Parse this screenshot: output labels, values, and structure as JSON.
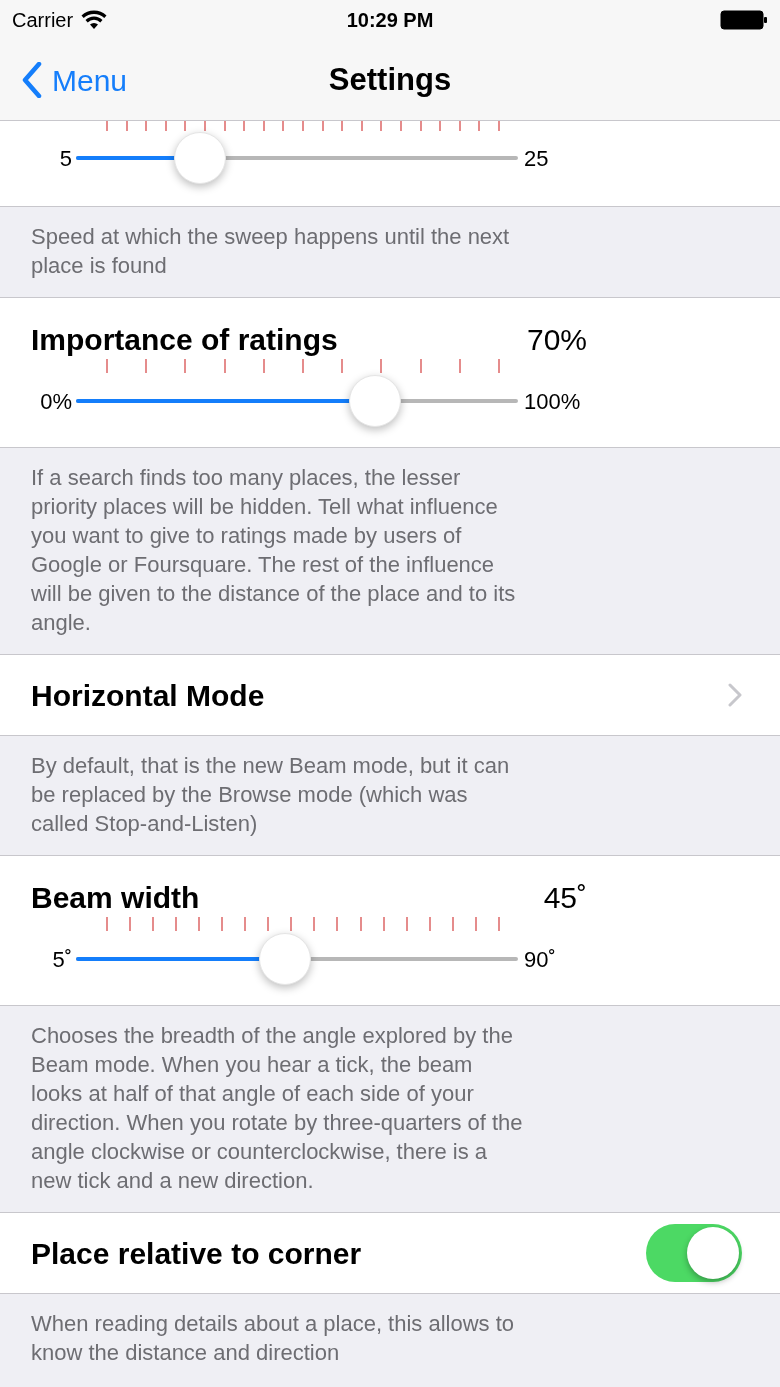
{
  "status_bar": {
    "carrier": "Carrier",
    "time": "10:29 PM"
  },
  "nav": {
    "back": "Menu",
    "title": "Settings"
  },
  "sections": [
    {
      "kind": "slider",
      "min_label": "5",
      "max_label": "25",
      "level": 0.25
    },
    {
      "kind": "footer",
      "text": "Speed at which the sweep happens until the next place is found"
    },
    {
      "kind": "slider",
      "title": "Importance of ratings",
      "value": "70%",
      "min_label": "0%",
      "max_label": "100%",
      "level": 0.7
    },
    {
      "kind": "footer",
      "text": "If a search finds too many places, the lesser priority places will be hidden. Tell what influence you want to give to ratings made by users of Google or Foursquare. The rest of the influence will be given to the distance of the place and to its angle."
    },
    {
      "kind": "disclosure",
      "title": "Horizontal Mode"
    },
    {
      "kind": "footer",
      "text": "By default, that is the new Beam mode, but it can be replaced by the Browse mode (which was called Stop-and-Listen)"
    },
    {
      "kind": "slider",
      "title": "Beam width",
      "value": "45˚",
      "min_label": "5˚",
      "max_label": "90˚",
      "level": 0.47
    },
    {
      "kind": "footer",
      "text": "Chooses the breadth of the angle explored by the Beam mode. When you hear a tick, the beam looks at half of that angle of each side of your direction. When you rotate by three-quarters of the angle clockwise or counterclockwise, there is a new tick and a new direction."
    },
    {
      "kind": "toggle",
      "title": "Place relative to corner",
      "on": true
    },
    {
      "kind": "footer",
      "text": "When reading details about a place, this allows to know the distance and direction"
    }
  ]
}
